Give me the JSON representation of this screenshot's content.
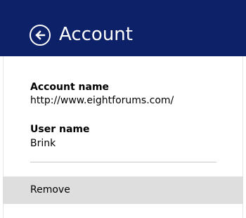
{
  "header": {
    "title": "Account",
    "back_icon": "back-arrow-circle-icon",
    "background_color": "#0c2167"
  },
  "account": {
    "account_name_label": "Account name",
    "account_name_value": "http://www.eightforums.com/",
    "user_name_label": "User name",
    "user_name_value": "Brink"
  },
  "actions": {
    "remove_label": "Remove"
  }
}
